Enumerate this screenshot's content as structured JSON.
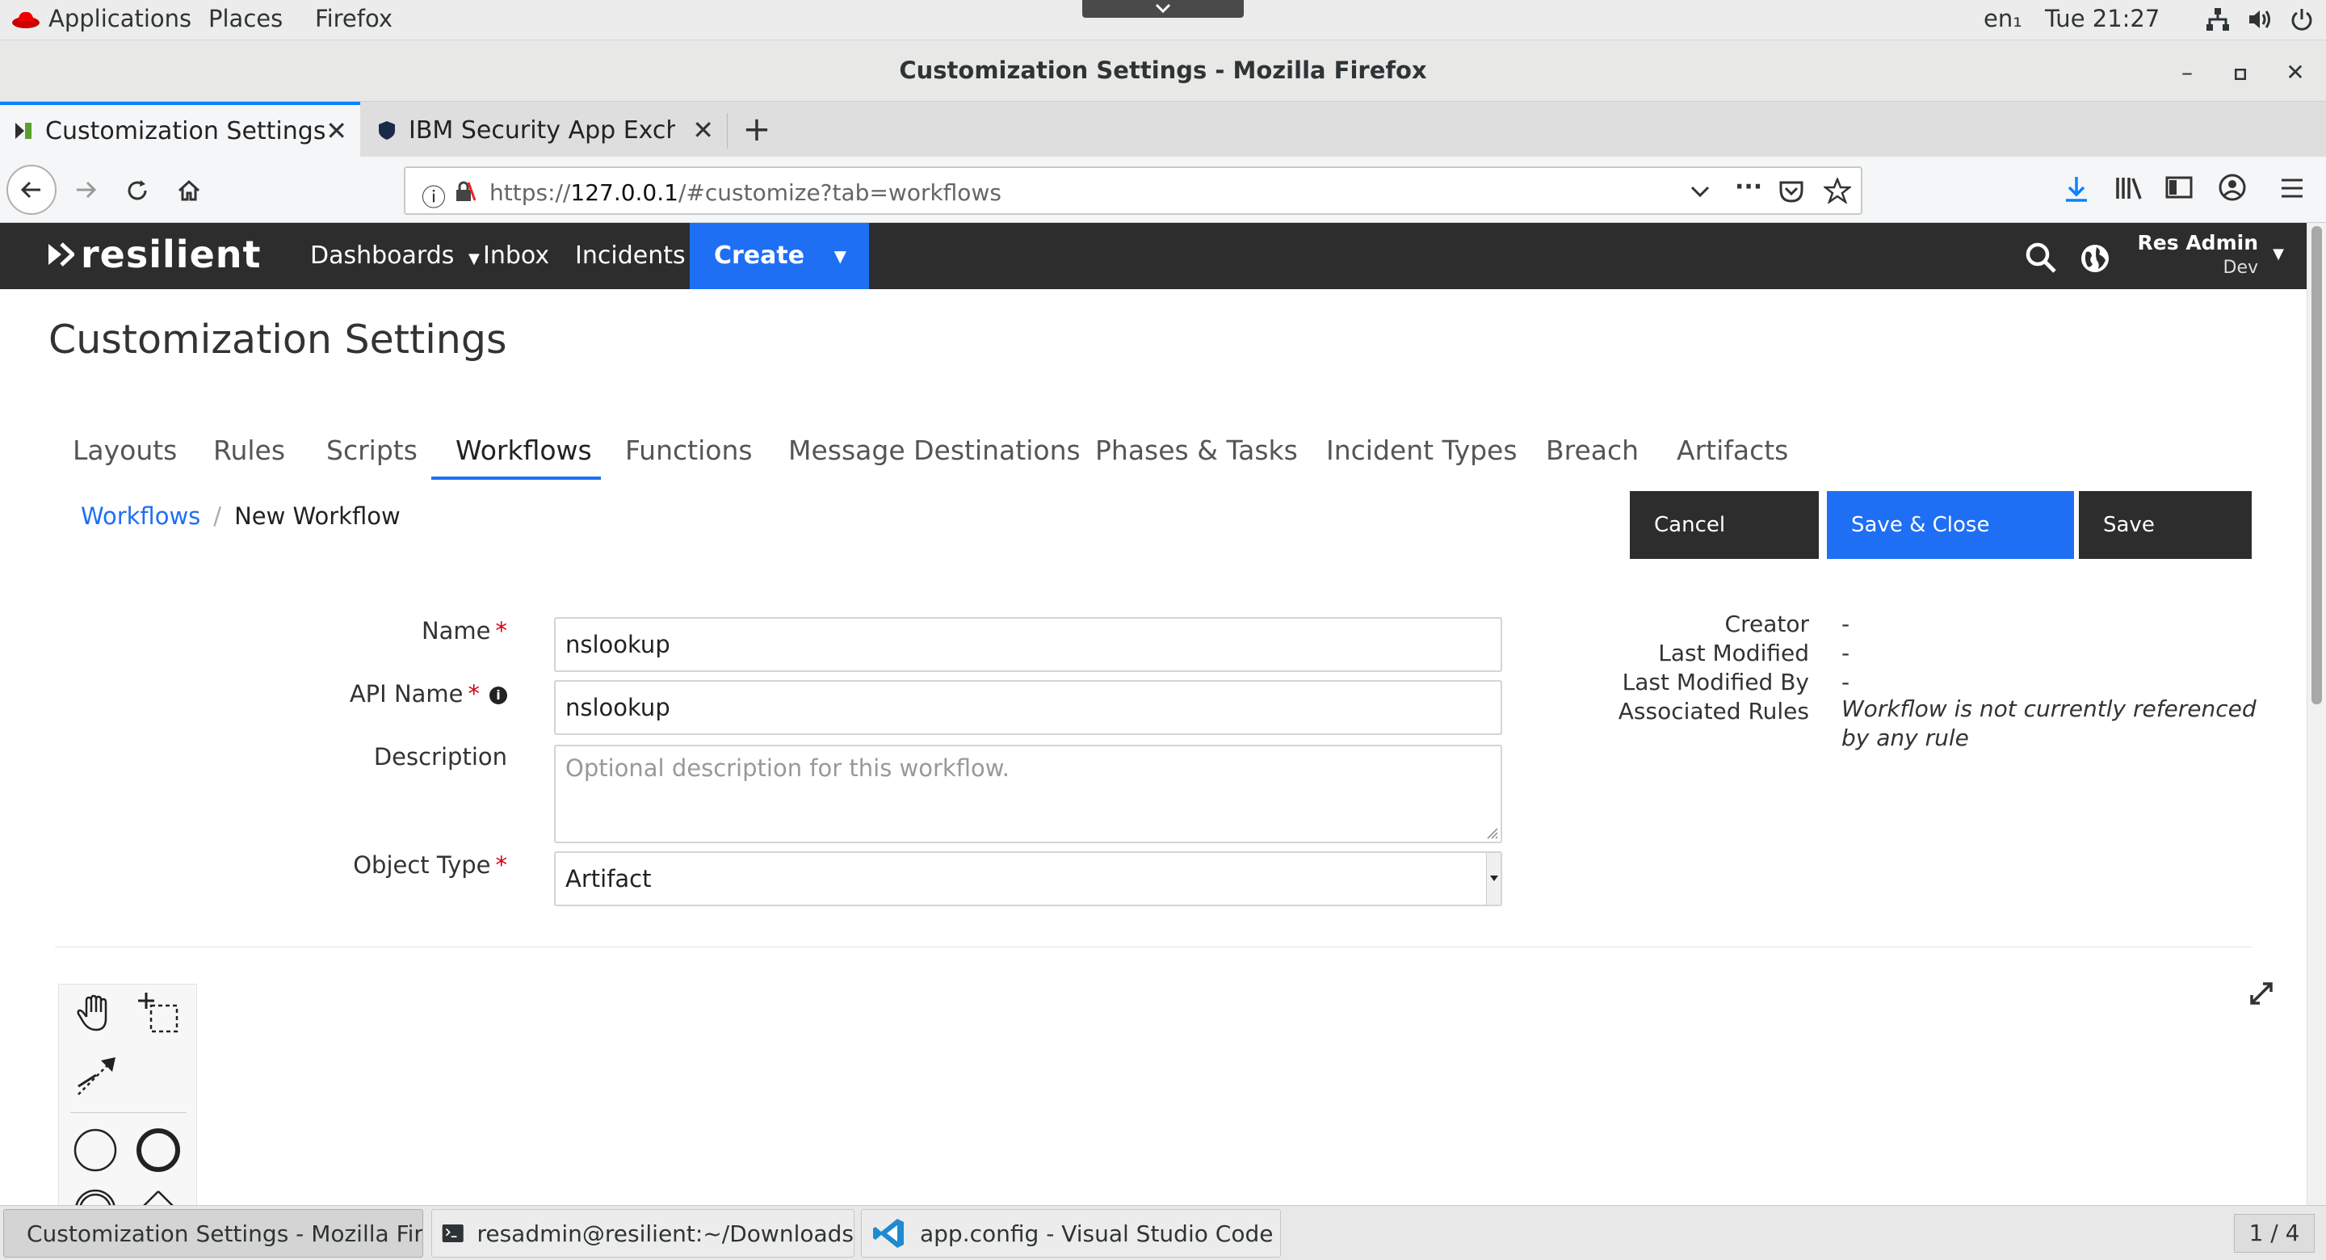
{
  "system_bar": {
    "menus": [
      "Applications",
      "Places",
      "Firefox"
    ],
    "keyboard_layout": "en₁",
    "clock": "Tue 21:27"
  },
  "window": {
    "title": "Customization Settings - Mozilla Firefox"
  },
  "browser": {
    "tabs": [
      {
        "label": "Customization Settings",
        "active": true
      },
      {
        "label": "IBM Security App Exchang",
        "active": false
      }
    ],
    "url_prefix": "https://",
    "url_host": "127.0.0.1",
    "url_path": "/#customize?tab=workflows"
  },
  "app": {
    "logo": "resilient",
    "nav": [
      "Dashboards",
      "Inbox",
      "Incidents"
    ],
    "create_label": "Create",
    "user_name": "Res Admin",
    "user_org": "Dev"
  },
  "page": {
    "title": "Customization Settings",
    "tabs": [
      "Layouts",
      "Rules",
      "Scripts",
      "Workflows",
      "Functions",
      "Message Destinations",
      "Phases & Tasks",
      "Incident Types",
      "Breach",
      "Artifacts"
    ],
    "active_tab": "Workflows",
    "breadcrumb": {
      "parent": "Workflows",
      "current": "New Workflow"
    },
    "buttons": {
      "cancel": "Cancel",
      "save_close": "Save & Close",
      "save": "Save"
    }
  },
  "form": {
    "name_label": "Name",
    "name_value": "nslookup",
    "api_name_label": "API Name",
    "api_name_value": "nslookup",
    "description_label": "Description",
    "description_placeholder": "Optional description for this workflow.",
    "object_type_label": "Object Type",
    "object_type_value": "Artifact",
    "required_mark": "*"
  },
  "meta": {
    "creator_label": "Creator",
    "creator_value": "-",
    "last_modified_label": "Last Modified",
    "last_modified_value": "-",
    "last_modified_by_label": "Last Modified By",
    "last_modified_by_value": "-",
    "associated_rules_label": "Associated Rules",
    "associated_rules_value": "Workflow is not currently referenced by any rule"
  },
  "taskbar": {
    "items": [
      {
        "label": "Customization Settings - Mozilla Fir...",
        "icon": "firefox-icon",
        "active": true
      },
      {
        "label": "resadmin@resilient:~/Downloads",
        "icon": "terminal-icon",
        "active": false
      },
      {
        "label": "app.config - Visual Studio Code",
        "icon": "vscode-icon",
        "active": false
      }
    ],
    "workspace": "1 / 4"
  },
  "colors": {
    "accent_blue": "#1f6ff4",
    "header_dark": "#2d2d2d",
    "button_dark": "#2d2d2d",
    "required_red": "#d0021b"
  }
}
